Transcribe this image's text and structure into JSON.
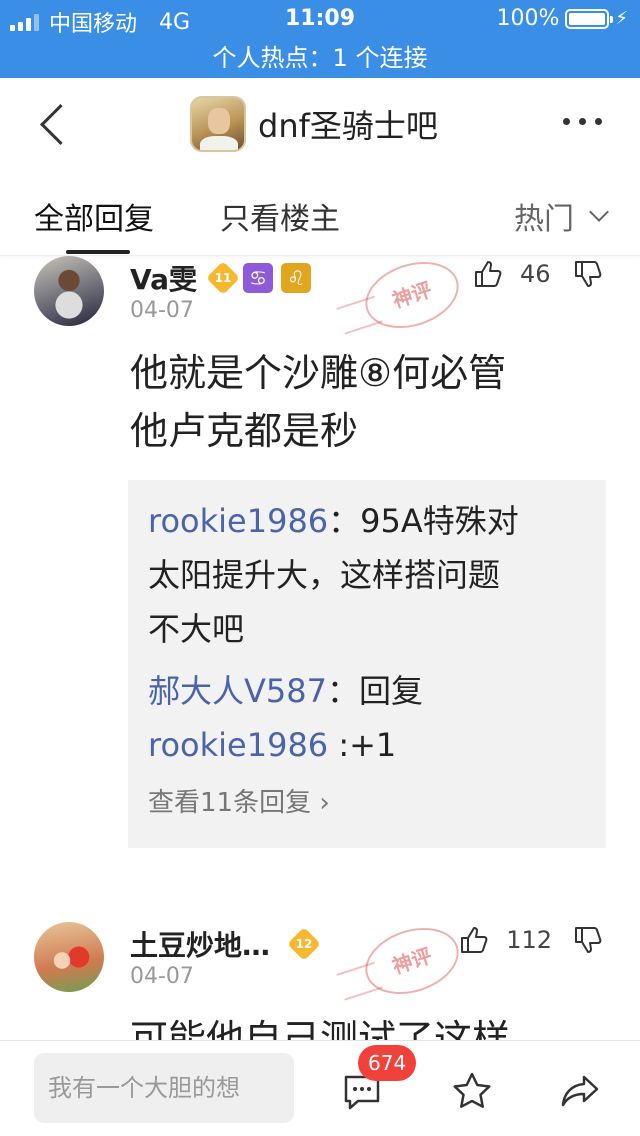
{
  "status_bar": {
    "carrier": "中国移动",
    "network": "4G",
    "time": "11:09",
    "battery": "100%"
  },
  "hotspot_banner": "个人热点：1 个连接",
  "nav": {
    "title": "dnf圣骑士吧"
  },
  "tabs": {
    "all_replies": "全部回复",
    "op_only": "只看楼主",
    "sort": "热门"
  },
  "posts": [
    {
      "username": "Va雯",
      "level": "11",
      "badge1": "♋",
      "badge2": "♌",
      "date": "04-07",
      "stamp": "神评",
      "likes": "46",
      "content_line1": "他就是个沙雕⑧何必管",
      "content_line2": "他卢克都是秒",
      "replies": [
        {
          "name": "rookie1986",
          "sep": "：",
          "text1": "95A特殊对",
          "text2": "太阳提升大，这样搭问题",
          "text3": "不大吧"
        },
        {
          "name": "郝大人V587",
          "sep": "：",
          "text1": "回复"
        },
        {
          "name": "rookie1986",
          "sep": " :",
          "text1": "+1"
        }
      ],
      "view_more": "查看11条回复 ›"
    },
    {
      "username": "土豆炒地…",
      "level": "12",
      "date": "04-07",
      "stamp": "神评",
      "likes": "112",
      "content_line1": "可能他自己测试了这样"
    }
  ],
  "bottom_bar": {
    "input_placeholder": "我有一个大胆的想",
    "comment_count": "674"
  },
  "colors": {
    "accent": "#3a8ee6",
    "reply_name": "#4a64a8",
    "badge_red": "#f0413a",
    "level_gold": "#f5b82e",
    "zodiac_purple": "#8e5ad8",
    "zodiac_gold": "#e2a51e"
  },
  "icons": [
    "back-icon",
    "more-icon",
    "chevron-down-icon",
    "thumbs-up-icon",
    "thumbs-down-icon",
    "comment-icon",
    "star-icon",
    "share-icon"
  ]
}
